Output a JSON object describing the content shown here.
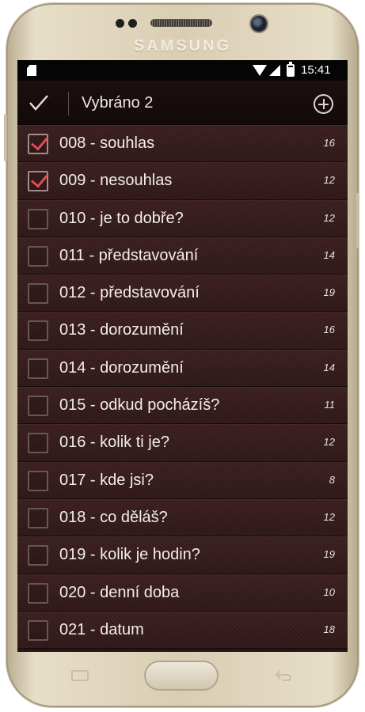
{
  "device": {
    "brand": "SAMSUNG"
  },
  "statusbar": {
    "time": "15:41",
    "icons": [
      "sd-card-icon",
      "wifi-icon",
      "signal-icon",
      "battery-icon"
    ]
  },
  "actionbar": {
    "title": "Vybráno 2",
    "left_icon": "check-icon",
    "right_icon": "add-circle-icon"
  },
  "colors": {
    "accent_check": "#e24b55",
    "row_bg": "#3c1f20",
    "actionbar_bg": "#1c0f10"
  },
  "list": {
    "items": [
      {
        "label": "008 - souhlas",
        "count": "16",
        "checked": true
      },
      {
        "label": "009 - nesouhlas",
        "count": "12",
        "checked": true
      },
      {
        "label": "010 - je to dobře?",
        "count": "12",
        "checked": false
      },
      {
        "label": "011 - představování",
        "count": "14",
        "checked": false
      },
      {
        "label": "012 - představování",
        "count": "19",
        "checked": false
      },
      {
        "label": "013 - dorozumění",
        "count": "16",
        "checked": false
      },
      {
        "label": "014 - dorozumění",
        "count": "14",
        "checked": false
      },
      {
        "label": "015 - odkud pocházíš?",
        "count": "11",
        "checked": false
      },
      {
        "label": "016 - kolik ti je?",
        "count": "12",
        "checked": false
      },
      {
        "label": "017 - kde jsi?",
        "count": "8",
        "checked": false
      },
      {
        "label": "018 - co děláš?",
        "count": "12",
        "checked": false
      },
      {
        "label": "019 - kolik je hodin?",
        "count": "19",
        "checked": false
      },
      {
        "label": "020 - denní doba",
        "count": "10",
        "checked": false
      },
      {
        "label": "021 - datum",
        "count": "18",
        "checked": false
      }
    ]
  }
}
